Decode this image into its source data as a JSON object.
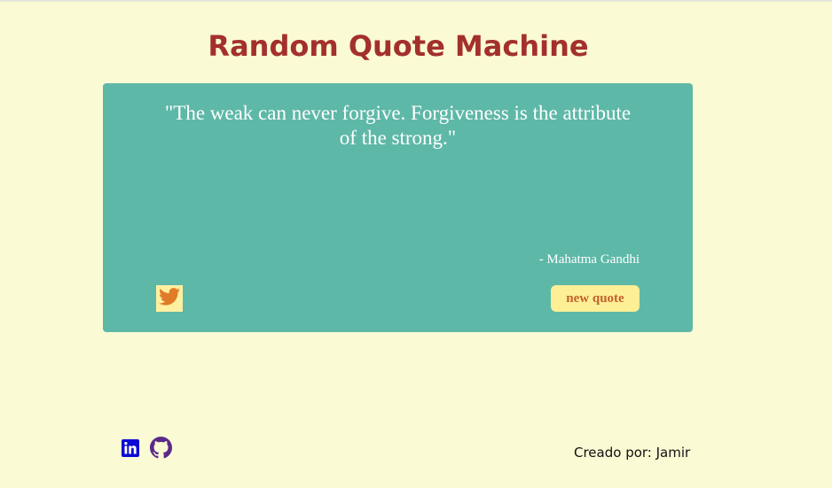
{
  "header": {
    "title": "Random Quote Machine"
  },
  "quote": {
    "text": "\"The weak can never forgive. Forgiveness is the attribute of the strong.\"",
    "author": "- Mahatma Gandhi"
  },
  "actions": {
    "tweet_icon": "twitter-icon",
    "new_quote_label": "new quote"
  },
  "footer": {
    "links": [
      {
        "icon": "linkedin-icon"
      },
      {
        "icon": "github-icon"
      }
    ],
    "credit": "Creado por: Jamir"
  },
  "colors": {
    "background": "#fafad4",
    "title": "#a3302b",
    "quote_box": "#5eb8a7",
    "button_bg": "#fcef96",
    "button_text": "#c2612b",
    "twitter_icon": "#e07b28",
    "linkedin_icon": "#0a0ad6",
    "github_icon": "#5a2a8a"
  }
}
